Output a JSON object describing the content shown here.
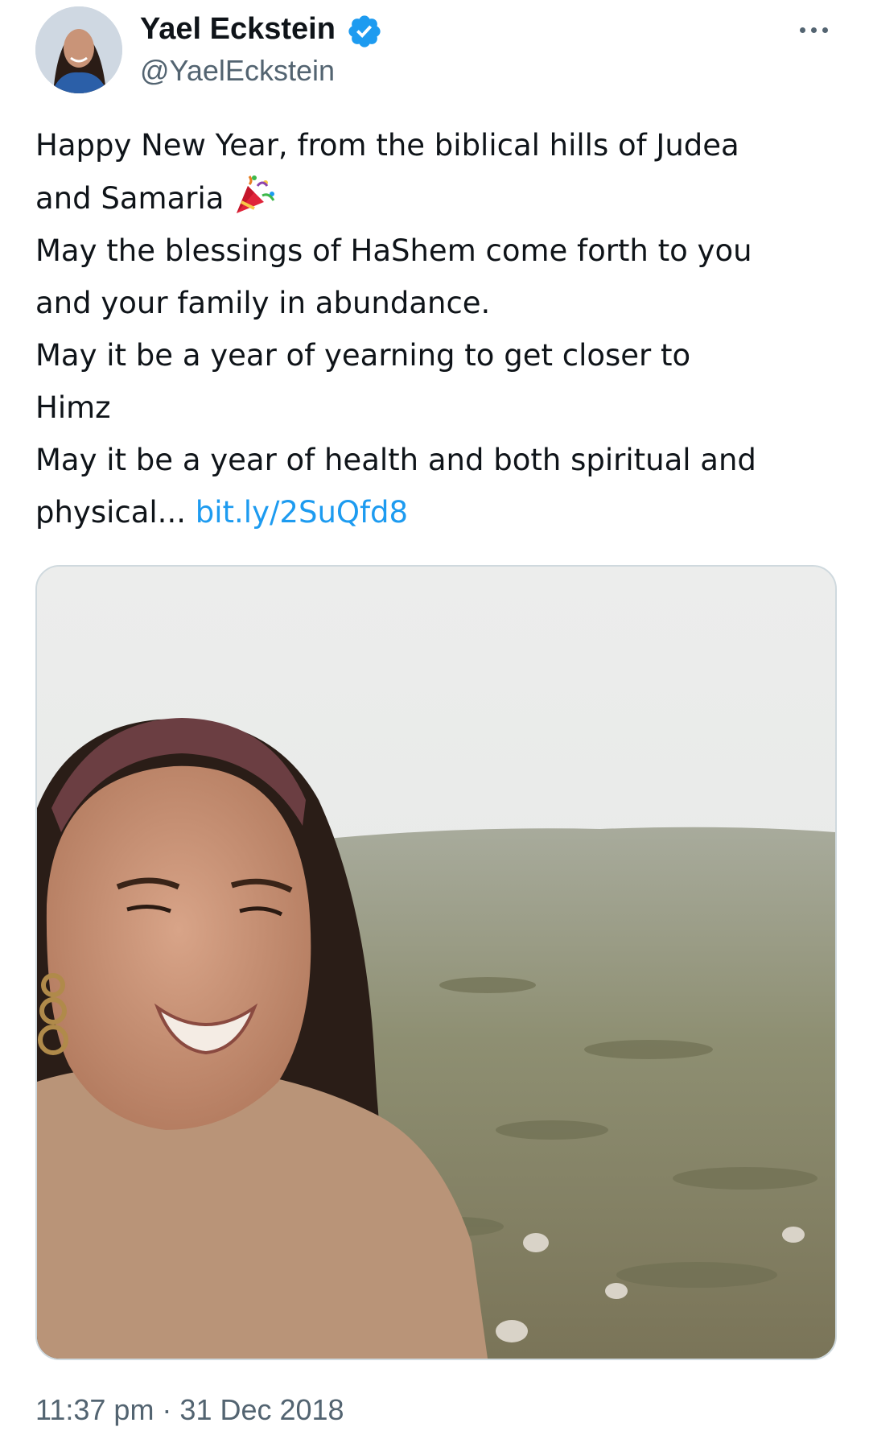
{
  "author": {
    "display_name": "Yael Eckstein",
    "handle": "@YaelEckstein",
    "verified_icon": "verified-badge-icon",
    "verified_color": "#1d9bf0"
  },
  "menu": {
    "icon": "more-options-icon"
  },
  "tweet": {
    "lines": [
      "Happy New Year, from the biblical hills of Judea",
      "and Samaria",
      "May the blessings of HaShem come forth to you",
      "and your family in abundance.",
      "May it be a year of yearning to get closer to",
      "Himz",
      "May it be a year of health and both spiritual and",
      "physical..."
    ],
    "emoji": "party-popper-icon",
    "link_text": "bit.ly/2SuQfd8"
  },
  "timestamp": "11:37 pm · 31 Dec 2018",
  "colors": {
    "text": "#0f1419",
    "secondary": "#536471",
    "link": "#1d9bf0",
    "border": "#cfd9de"
  }
}
